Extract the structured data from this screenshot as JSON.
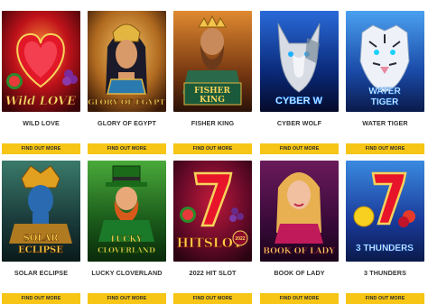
{
  "games": [
    {
      "title": "WILD LOVE",
      "cta": "FIND OUT MORE",
      "icon": "heart-icon",
      "logo": "Wild LOVE"
    },
    {
      "title": "GLORY OF EGYPT",
      "cta": "FIND OUT MORE",
      "icon": "pharaoh-icon",
      "logo": "GLORY OF EGYPT"
    },
    {
      "title": "FISHER KING",
      "cta": "FIND OUT MORE",
      "icon": "king-icon",
      "logo": "FISHER KING"
    },
    {
      "title": "CYBER WOLF",
      "cta": "FIND OUT MORE",
      "icon": "wolf-icon",
      "logo": "CYBER WOLF"
    },
    {
      "title": "WATER TIGER",
      "cta": "FIND OUT MORE",
      "icon": "tiger-icon",
      "logo": "WATER TIGER"
    },
    {
      "title": "SOLAR ECLIPSE",
      "cta": "FIND OUT MORE",
      "icon": "sun-warrior-icon",
      "logo": "SOLAR ECLIPSE"
    },
    {
      "title": "LUCKY CLOVERLAND",
      "cta": "FIND OUT MORE",
      "icon": "leprechaun-icon",
      "logo": "LUCKY CLOVERLAND"
    },
    {
      "title": "2022 HIT SLOT",
      "cta": "FIND OUT MORE",
      "icon": "seven-icon",
      "logo": "HITSLOT",
      "logo_badge": "2022"
    },
    {
      "title": "BOOK OF LADY",
      "cta": "FIND OUT MORE",
      "icon": "lady-icon",
      "logo": "BOOK OF LADY"
    },
    {
      "title": "3 THUNDERS",
      "cta": "FIND OUT MORE",
      "icon": "seven-fruit-icon",
      "logo": "3 THUNDERS"
    }
  ],
  "colors": {
    "accent": "#f6c515",
    "title": "#333333"
  }
}
